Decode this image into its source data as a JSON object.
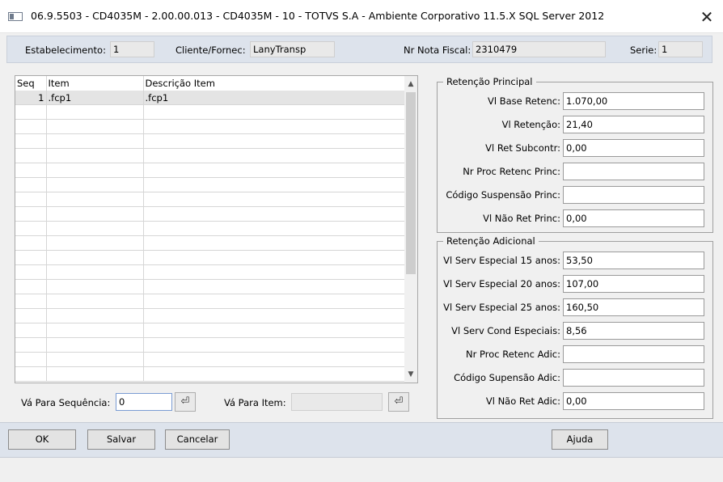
{
  "window": {
    "title": "06.9.5503 - CD4035M - 2.00.00.013 - CD4035M - 10 - TOTVS S.A - Ambiente Corporativo 11.5.X SQL Server 2012",
    "close_glyph": "✕"
  },
  "header": {
    "estabelecimento_label": "Estabelecimento:",
    "estabelecimento_value": "1",
    "cliente_label": "Cliente/Fornec:",
    "cliente_value": "LanyTransp",
    "nota_label": "Nr Nota Fiscal:",
    "nota_value": "2310479",
    "serie_label": "Serie:",
    "serie_value": "1"
  },
  "grid": {
    "columns": [
      "Seq",
      "Item",
      "Descrição Item"
    ],
    "rows": [
      {
        "seq": "1",
        "item": ".fcp1",
        "descricao": ".fcp1"
      }
    ],
    "empty_rows": 19
  },
  "goto": {
    "seq_label": "Vá Para Sequência:",
    "seq_value": "0",
    "item_label": "Vá Para Item:",
    "item_value": "",
    "go_icon": "⏎"
  },
  "retencao_principal": {
    "title": "Retenção Principal",
    "fields": [
      {
        "label": "Vl Base Retenc:",
        "value": "1.070,00"
      },
      {
        "label": "Vl Retenção:",
        "value": "21,40"
      },
      {
        "label": "Vl Ret Subcontr:",
        "value": "0,00"
      },
      {
        "label": "Nr Proc Retenc Princ:",
        "value": ""
      },
      {
        "label": "Código Suspensão Princ:",
        "value": ""
      },
      {
        "label": "Vl Não Ret Princ:",
        "value": "0,00"
      }
    ]
  },
  "retencao_adicional": {
    "title": "Retenção Adicional",
    "fields": [
      {
        "label": "Vl Serv Especial 15 anos:",
        "value": "53,50"
      },
      {
        "label": "Vl Serv Especial 20 anos:",
        "value": "107,00"
      },
      {
        "label": "Vl Serv Especial 25 anos:",
        "value": "160,50"
      },
      {
        "label": "Vl Serv Cond Especiais:",
        "value": "8,56"
      },
      {
        "label": "Nr Proc Retenc Adic:",
        "value": ""
      },
      {
        "label": "Código Supensão Adic:",
        "value": ""
      },
      {
        "label": "Vl Não Ret Adic:",
        "value": "0,00"
      }
    ]
  },
  "buttons": {
    "ok": "OK",
    "salvar": "Salvar",
    "cancelar": "Cancelar",
    "ajuda": "Ajuda"
  }
}
